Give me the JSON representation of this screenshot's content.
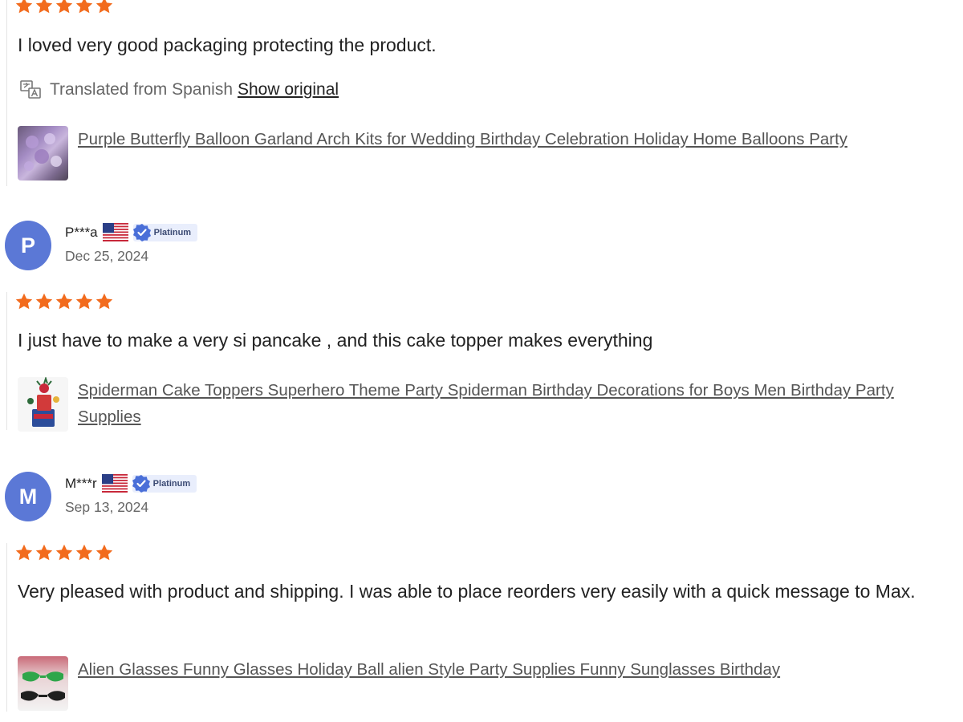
{
  "colors": {
    "star": "#f26b1d",
    "avatar": "#5b78d6",
    "badge_bg": "#e9eefc"
  },
  "reviews": [
    {
      "rating": 5,
      "text": "I loved very good packaging protecting the product.",
      "translated_label": "Translated from Spanish",
      "show_original": "Show original",
      "product_title": "Purple Butterfly Balloon Garland Arch Kits for Wedding Birthday Celebration Holiday Home Balloons Party",
      "icons": {
        "translate": "translate-icon"
      }
    },
    {
      "avatar_letter": "P",
      "username": "P***a",
      "badge": "Platinum",
      "date": "Dec 25, 2024",
      "rating": 5,
      "text": "I just have to make a very si pancake , and this cake topper makes everything",
      "product_title": "Spiderman Cake Toppers Superhero Theme Party Spiderman Birthday Decorations for Boys Men Birthday Party Supplies"
    },
    {
      "avatar_letter": "M",
      "username": "M***r",
      "badge": "Platinum",
      "date": "Sep 13, 2024",
      "rating": 5,
      "text": "Very pleased with product and shipping. I was able to place reorders very easily with a quick message to Max.",
      "product_title": "Alien Glasses Funny Glasses Holiday Ball alien Style Party Supplies Funny Sunglasses Birthday"
    }
  ]
}
